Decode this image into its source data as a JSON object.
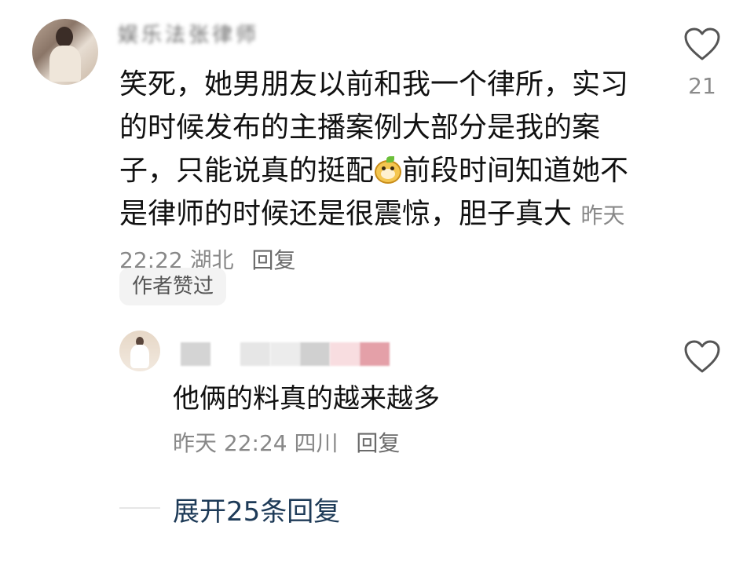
{
  "main_comment": {
    "username": "娱乐法张律师",
    "text": "笑死，她男朋友以前和我一个律所，实习的时候发布的主播案例大部分是我的案子，只能说真的挺配",
    "emoji_icon": "funny-face-emoji-icon",
    "text_after_emoji": "前段时间知道她不是律师的时候还是很震惊，胆子真大",
    "time": "昨天 22:22",
    "location": "湖北",
    "reply_label": "回复",
    "author_badge": "作者赞过",
    "like_count": "21"
  },
  "reply_comment": {
    "text": "他俩的料真的越来越多",
    "time": "昨天 22:24",
    "location": "四川",
    "reply_label": "回复"
  },
  "expand_label": "展开25条回复",
  "colors": {
    "text": "#111111",
    "meta": "#888888",
    "expand_link": "#1d3a57",
    "heart_stroke": "#555555",
    "badge_bg": "#f3f3f3"
  }
}
